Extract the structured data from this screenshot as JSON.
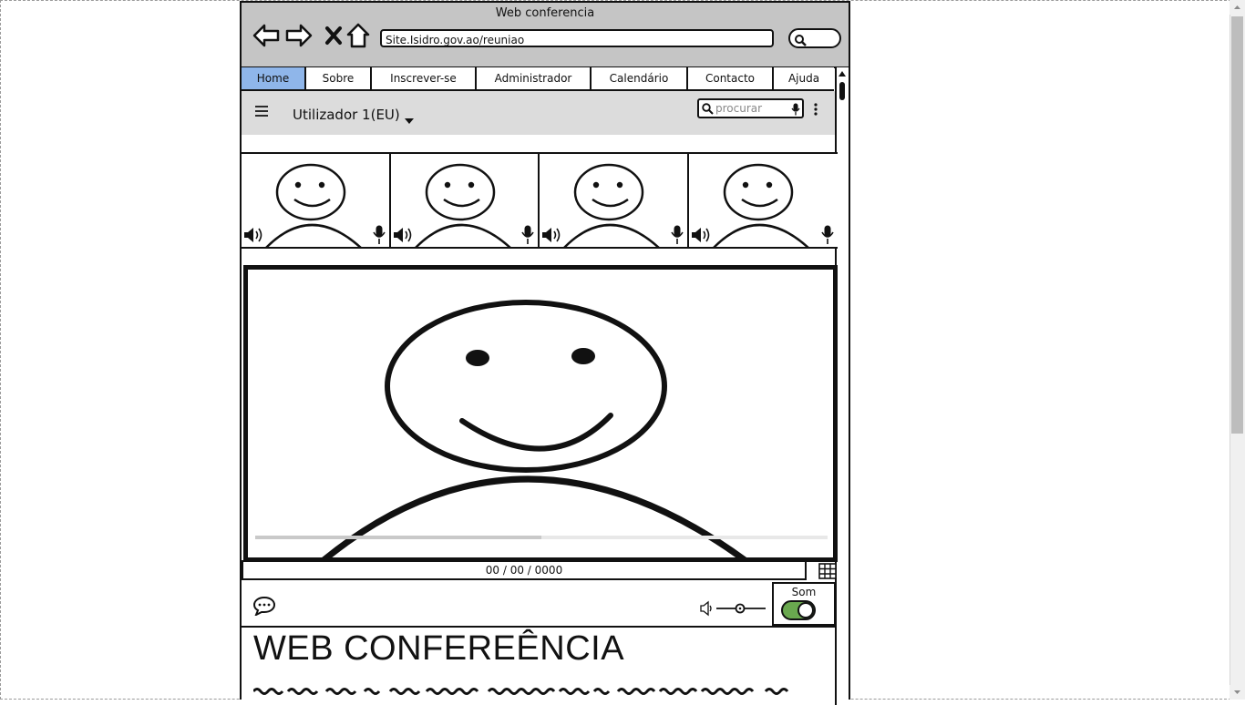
{
  "window": {
    "title": "Web conferencia"
  },
  "browser": {
    "url": "Site.Isidro.gov.ao/reuniao",
    "nav_icons": [
      "back-arrow-icon",
      "forward-arrow-icon",
      "stop-icon",
      "home-icon"
    ]
  },
  "menu": {
    "tabs": [
      {
        "label": "Home",
        "active": true
      },
      {
        "label": "Sobre",
        "active": false
      },
      {
        "label": "Inscrever-se",
        "active": false
      },
      {
        "label": "Administrador",
        "active": false
      },
      {
        "label": "Calendário",
        "active": false
      },
      {
        "label": "Contacto",
        "active": false
      },
      {
        "label": "Ajuda",
        "active": false
      }
    ],
    "active_color": "#8fb6ea"
  },
  "app_header": {
    "user": "Utilizador 1(EU)",
    "search_placeholder": "procurar"
  },
  "participants": {
    "count": 4
  },
  "player": {
    "progress": 0.5,
    "time": "00  / 00 / 0000"
  },
  "controls": {
    "sound_label": "Som",
    "sound_on": true,
    "toggle_color": "#6aa84f"
  },
  "content": {
    "heading": "WEB CONFEREÊNCIA"
  }
}
